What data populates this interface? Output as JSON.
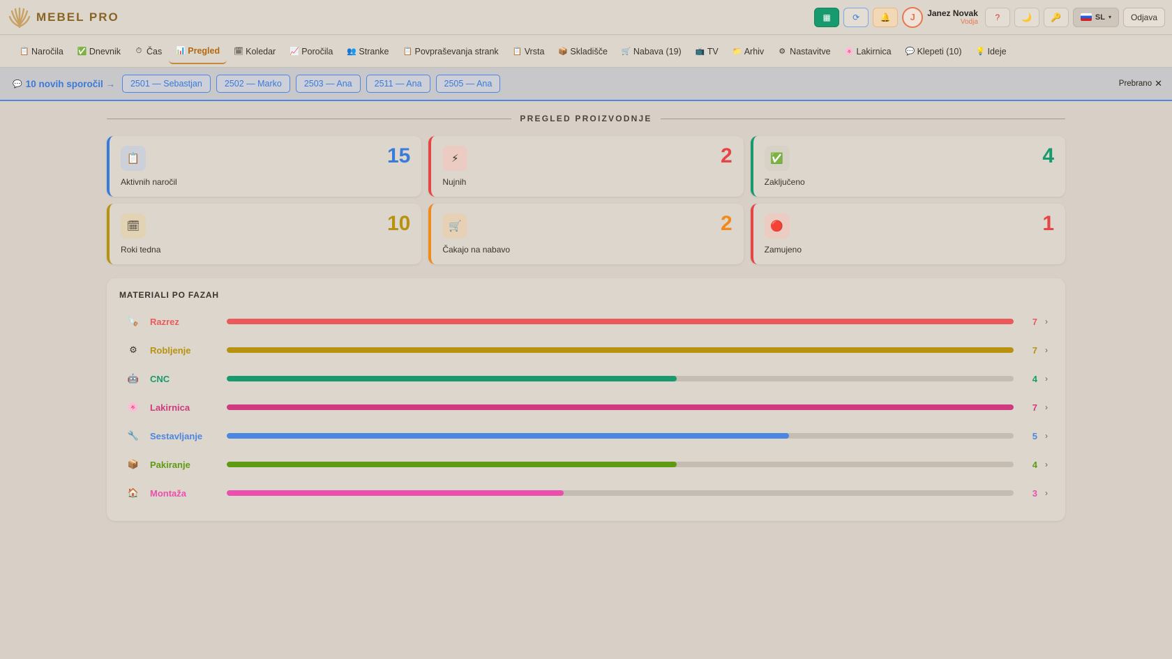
{
  "header": {
    "app_name": "MEBEL PRO",
    "user_initial": "J",
    "user_name": "Janez Novak",
    "user_role": "Vodja",
    "language": "SL",
    "logout_label": "Odjava",
    "help_label": "?"
  },
  "nav": [
    {
      "label": "Naročila",
      "icon": "clipboard-icon",
      "glyph": "📋"
    },
    {
      "label": "Dnevnik",
      "icon": "check-icon",
      "glyph": "✅"
    },
    {
      "label": "Čas",
      "icon": "timer-icon",
      "glyph": "⏱"
    },
    {
      "label": "Pregled",
      "icon": "chart-icon",
      "glyph": "📊",
      "active": true
    },
    {
      "label": "Koledar",
      "icon": "calendar-icon",
      "glyph": "🗓"
    },
    {
      "label": "Poročila",
      "icon": "trend-icon",
      "glyph": "📈"
    },
    {
      "label": "Stranke",
      "icon": "people-icon",
      "glyph": "👥"
    },
    {
      "label": "Povpraševanja strank",
      "icon": "clipboard-icon",
      "glyph": "📋"
    },
    {
      "label": "Vrsta",
      "icon": "clipboard-icon",
      "glyph": "📋"
    },
    {
      "label": "Skladišče",
      "icon": "box-icon",
      "glyph": "📦"
    },
    {
      "label": "Nabava (19)",
      "icon": "cart-icon",
      "glyph": "🛒"
    },
    {
      "label": "TV",
      "icon": "tv-icon",
      "glyph": "📺"
    },
    {
      "label": "Arhiv",
      "icon": "folder-icon",
      "glyph": "📁"
    },
    {
      "label": "Nastavitve",
      "icon": "gear-icon",
      "glyph": "⚙"
    },
    {
      "label": "Lakirnica",
      "icon": "paint-icon",
      "glyph": "🌸"
    },
    {
      "label": "Klepeti (10)",
      "icon": "chat-icon",
      "glyph": "💬"
    },
    {
      "label": "Ideje",
      "icon": "bulb-icon",
      "glyph": "💡"
    }
  ],
  "messages": {
    "title": "10 novih sporočil →",
    "chips": [
      "2501 — Sebastjan",
      "2502 — Marko",
      "2503 — Ana",
      "2511 — Ana",
      "2505 — Ana"
    ],
    "read_label": "Prebrano"
  },
  "overview": {
    "title": "PREGLED PROIZVODNJE",
    "cards": [
      {
        "label": "Aktivnih naročil",
        "value": "15",
        "color": "#3a7ad9",
        "icon": "clipboard-icon",
        "glyph": "📋",
        "icon_bg": "#ccd1d9"
      },
      {
        "label": "Nujnih",
        "value": "2",
        "color": "#e54545",
        "icon": "lightning-icon",
        "glyph": "⚡",
        "icon_bg": "#ebcbc2"
      },
      {
        "label": "Zaključeno",
        "value": "4",
        "color": "#179a6d",
        "icon": "check-icon",
        "glyph": "✅",
        "icon_bg": "#d6d3c6"
      },
      {
        "label": "Roki tedna",
        "value": "10",
        "color": "#b8920f",
        "icon": "calendar-icon",
        "glyph": "🗓",
        "icon_bg": "#e3d3b5"
      },
      {
        "label": "Čakajo na nabavo",
        "value": "2",
        "color": "#f08a1c",
        "icon": "cart-icon",
        "glyph": "🛒",
        "icon_bg": "#e6d0b6"
      },
      {
        "label": "Zamujeno",
        "value": "1",
        "color": "#e54545",
        "icon": "red-circle-icon",
        "glyph": "🔴",
        "icon_bg": "#ebcbc2"
      }
    ]
  },
  "materials": {
    "title": "MATERIALI PO FAZAH",
    "max": 7,
    "phases": [
      {
        "name": "Razrez",
        "count": 7,
        "color": "#ea5a5a",
        "icon": "saw-icon",
        "glyph": "🪚"
      },
      {
        "name": "Robljenje",
        "count": 7,
        "color": "#b8920f",
        "icon": "gear-icon",
        "glyph": "⚙"
      },
      {
        "name": "CNC",
        "count": 4,
        "color": "#179a6d",
        "icon": "robot-icon",
        "glyph": "🤖"
      },
      {
        "name": "Lakirnica",
        "count": 7,
        "color": "#d03a7e",
        "icon": "paint-icon",
        "glyph": "🌸"
      },
      {
        "name": "Sestavljanje",
        "count": 5,
        "color": "#4d86e0",
        "icon": "wrench-icon",
        "glyph": "🔧"
      },
      {
        "name": "Pakiranje",
        "count": 4,
        "color": "#5e9a12",
        "icon": "box-icon",
        "glyph": "📦"
      },
      {
        "name": "Montaža",
        "count": 3,
        "color": "#ea4fae",
        "icon": "house-icon",
        "glyph": "🏠"
      }
    ]
  }
}
